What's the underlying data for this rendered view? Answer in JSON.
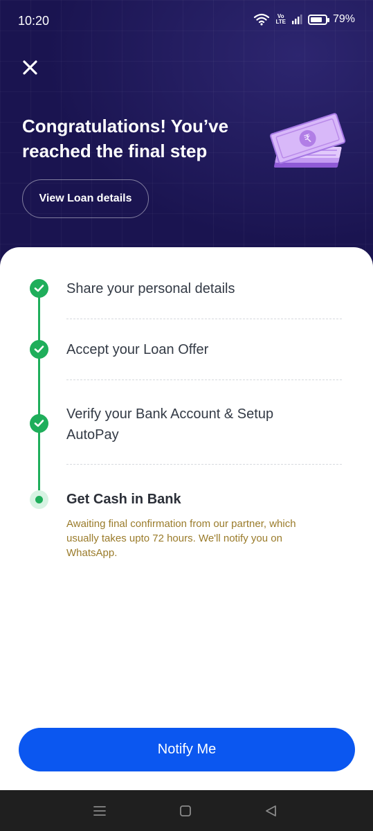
{
  "status_bar": {
    "time": "10:20",
    "volte_top": "Vo",
    "volte_bottom": "LTE",
    "battery": "79%",
    "battery_level": 0.79
  },
  "header": {
    "close_icon": "close-icon",
    "title_line1": "Congratulations! You’ve",
    "title_line2": "reached the final step",
    "view_loan_label": "View Loan details",
    "illustration_icon": "rupee-cash-stack-icon"
  },
  "steps": [
    {
      "label": "Share your personal details",
      "status": "done"
    },
    {
      "label": "Accept your Loan Offer",
      "status": "done"
    },
    {
      "label_line1": "Verify your Bank Account & Setup",
      "label_line2": "AutoPay",
      "status": "done"
    },
    {
      "label": "Get Cash in Bank",
      "status": "current",
      "note_line1": "Awaiting final confirmation from our partner, which",
      "note_line2": "usually takes upto 72 hours. We'll notify you on",
      "note_line3": "WhatsApp."
    }
  ],
  "notify_label": "Notify Me",
  "colors": {
    "hero_bg": "#1a1450",
    "success_green": "#1fae5b",
    "primary_blue": "#0b57f0",
    "note_text": "#9a7b2a"
  },
  "nav": {
    "recents_icon": "menu-icon",
    "home_icon": "home-square-icon",
    "back_icon": "back-triangle-icon"
  }
}
